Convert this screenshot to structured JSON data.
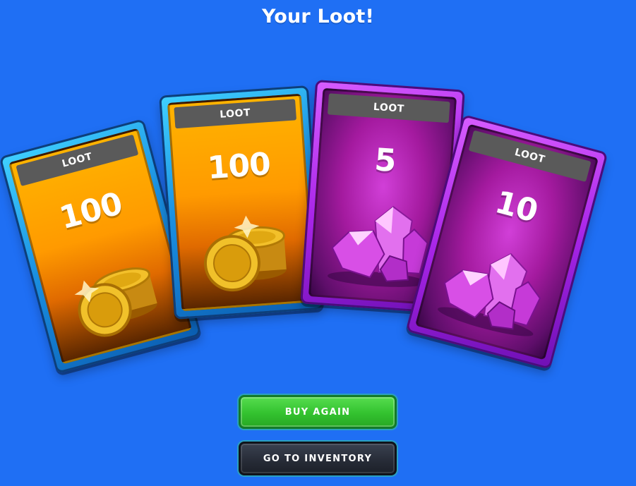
{
  "title": "Your Loot!",
  "cards": [
    {
      "tag": "LOOT",
      "amount": "100",
      "reward": "coins",
      "icon": "gold-coins-icon"
    },
    {
      "tag": "LOOT",
      "amount": "100",
      "reward": "coins",
      "icon": "gold-coins-icon"
    },
    {
      "tag": "LOOT",
      "amount": "5",
      "reward": "gems",
      "icon": "purple-gems-icon"
    },
    {
      "tag": "LOOT",
      "amount": "10",
      "reward": "gems",
      "icon": "purple-gems-icon"
    }
  ],
  "buttons": {
    "buy_again": "BUY AGAIN",
    "go_to_inventory": "GO TO INVENTORY"
  },
  "colors": {
    "background": "#1f6ff4",
    "coin_card_frame": "#1a8fe0",
    "gem_card_frame": "#a825e8",
    "buy_button": "#33c22f",
    "inventory_button": "#262b36"
  }
}
